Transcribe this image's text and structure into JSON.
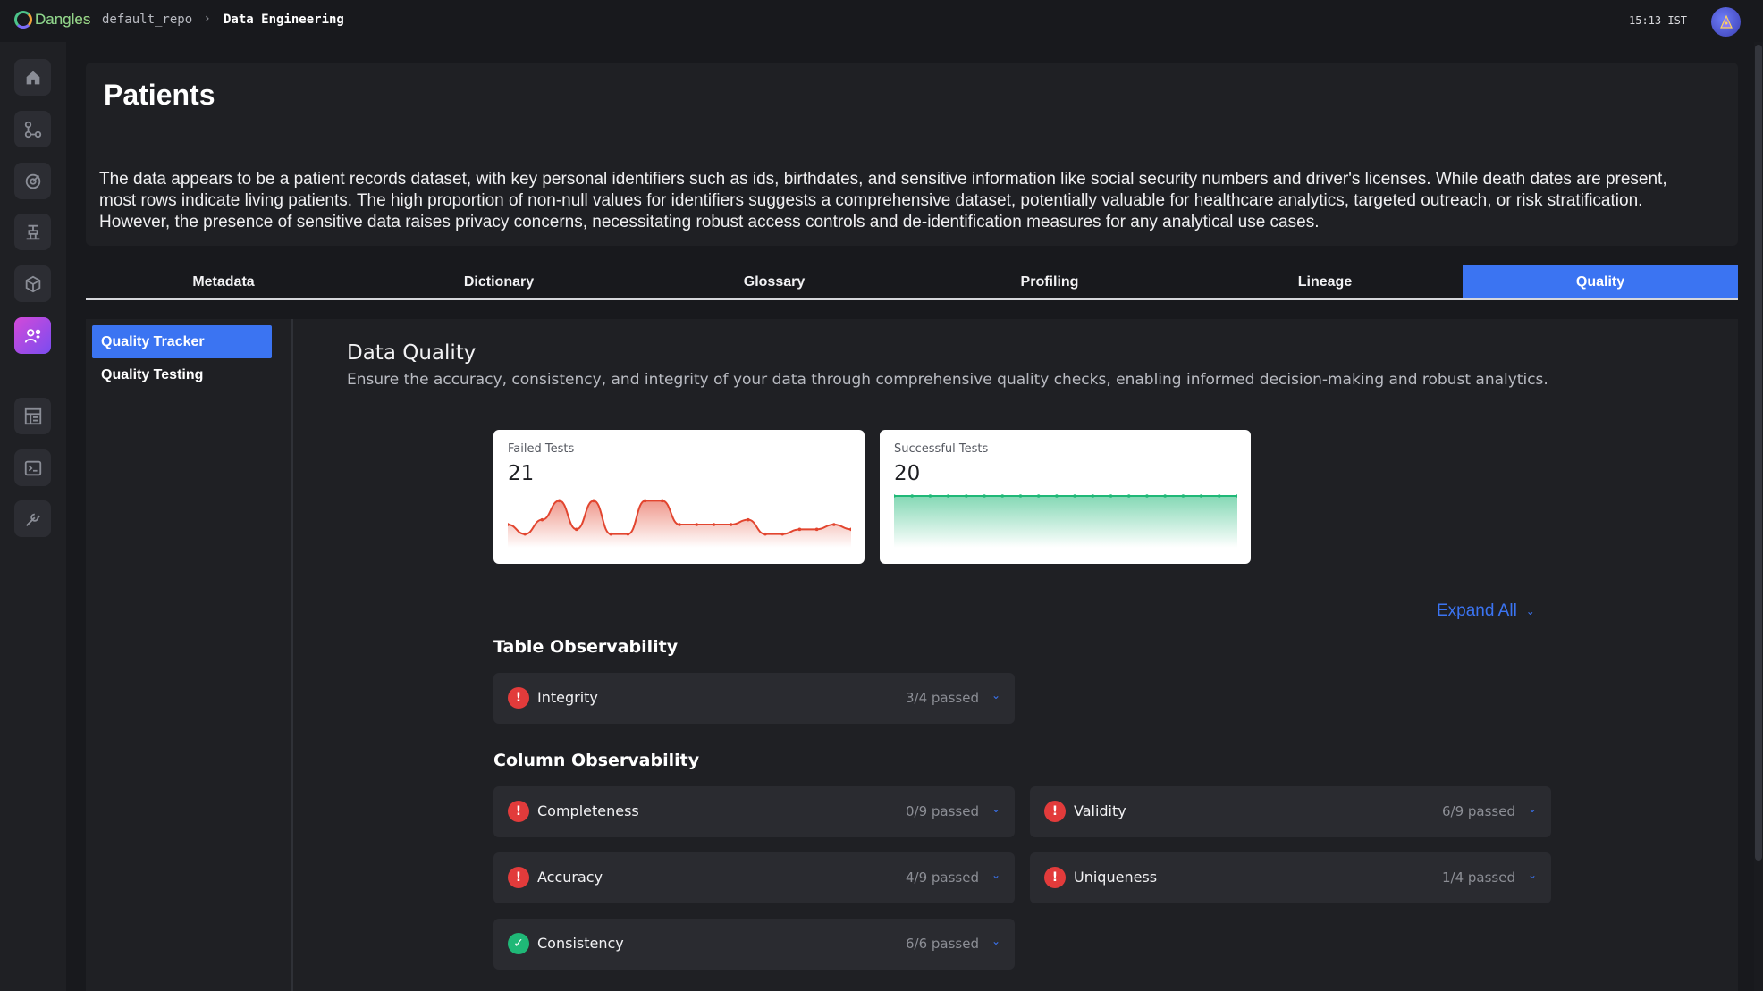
{
  "topbar": {
    "logo_text": "Dangles",
    "breadcrumb_repo": "default_repo",
    "breadcrumb_separator": "›",
    "breadcrumb_current": "Data Engineering",
    "clock": "15:13 IST"
  },
  "rail": {
    "icons": [
      "home-icon",
      "workflow-icon",
      "target-icon",
      "pipeline-icon",
      "package-icon",
      "data-steward-icon",
      "layout-icon",
      "terminal-icon",
      "wrench-icon"
    ],
    "active": "data-steward-icon"
  },
  "page": {
    "title": "Patients",
    "summary": "The data appears to be a patient records dataset, with key personal identifiers such as ids, birthdates, and sensitive information like social security numbers and driver's licenses. While death dates are present, most rows indicate living patients. The high proportion of non-null values for identifiers suggests a comprehensive dataset, potentially valuable for healthcare analytics, targeted outreach, or risk stratification. However, the presence of sensitive data raises privacy concerns, necessitating robust access controls and de-identification measures for any analytical use cases."
  },
  "tabs": [
    {
      "label": "Metadata",
      "active": false
    },
    {
      "label": "Dictionary",
      "active": false
    },
    {
      "label": "Glossary",
      "active": false
    },
    {
      "label": "Profiling",
      "active": false
    },
    {
      "label": "Lineage",
      "active": false
    },
    {
      "label": "Quality",
      "active": true
    }
  ],
  "subnav": [
    {
      "label": "Quality Tracker",
      "active": true
    },
    {
      "label": "Quality Testing",
      "active": false
    }
  ],
  "quality": {
    "title": "Data Quality",
    "description": "Ensure the accuracy, consistency, and integrity of your data through comprehensive quality checks, enabling informed decision-making and robust analytics.",
    "failed": {
      "label": "Failed Tests",
      "value": "21",
      "color": "#e2452f",
      "trend": [
        3,
        1,
        4,
        8,
        2,
        8,
        1,
        1,
        8,
        8,
        3,
        3,
        3,
        3,
        4,
        1,
        1,
        2,
        2,
        3,
        2
      ]
    },
    "successful": {
      "label": "Successful Tests",
      "value": "20",
      "color": "#1fb877",
      "trend": [
        20,
        20,
        20,
        20,
        20,
        20,
        20,
        20,
        20,
        20,
        20,
        20,
        20,
        20,
        20,
        20,
        20,
        20,
        20,
        20
      ]
    },
    "expand_all": "Expand All",
    "table_section": "Table Observability",
    "column_section": "Column Observability",
    "table_checks": [
      {
        "name": "Integrity",
        "result": "3/4 passed",
        "status": "fail"
      }
    ],
    "column_checks": [
      {
        "name": "Completeness",
        "result": "0/9 passed",
        "status": "fail"
      },
      {
        "name": "Validity",
        "result": "6/9 passed",
        "status": "fail"
      },
      {
        "name": "Accuracy",
        "result": "4/9 passed",
        "status": "fail"
      },
      {
        "name": "Uniqueness",
        "result": "1/4 passed",
        "status": "fail"
      },
      {
        "name": "Consistency",
        "result": "6/6 passed",
        "status": "pass"
      }
    ]
  }
}
